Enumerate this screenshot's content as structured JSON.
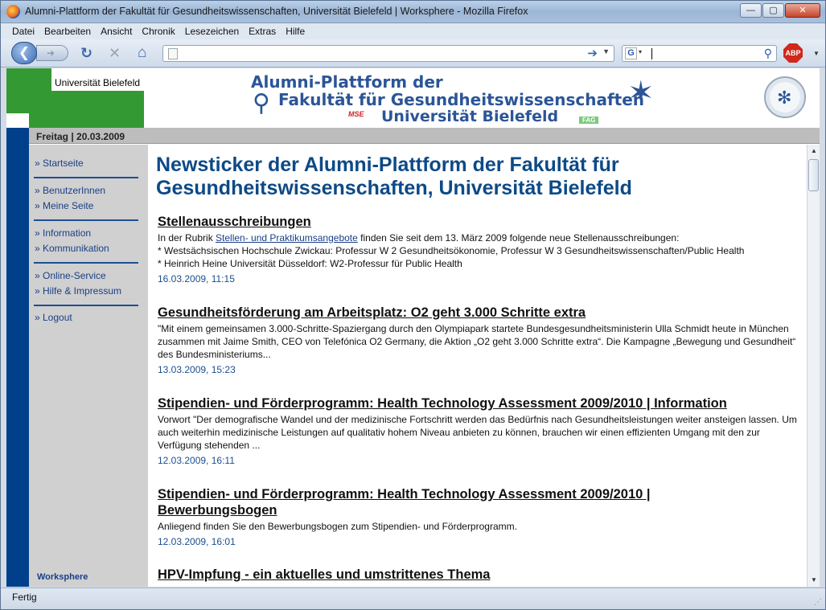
{
  "window": {
    "title": "Alumni-Plattform der Fakultät für Gesundheitswissenschaften, Universität Bielefeld | Worksphere - Mozilla Firefox",
    "minimize_glyph": "—",
    "maximize_glyph": "▢",
    "close_glyph": "✕"
  },
  "menu": [
    "Datei",
    "Bearbeiten",
    "Ansicht",
    "Chronik",
    "Lesezeichen",
    "Extras",
    "Hilfe"
  ],
  "toolbar": {
    "url_value": "",
    "search_value": "",
    "search_engine_letter": "G",
    "adblock_label": "ABP",
    "icons": [
      "back-icon",
      "forward-icon",
      "reload-icon",
      "stop-icon",
      "home-icon",
      "go-icon",
      "search-icon"
    ]
  },
  "site": {
    "university_label": "Universität Bielefeld",
    "banner": {
      "line1": "Alumni-Plattform der",
      "line2": "Fakultät für Gesundheitswissenschaften",
      "line3": "Universität Bielefeld",
      "mse_label": "MSE",
      "fag_label": "FAG"
    },
    "date": "Freitag | 20.03.2009"
  },
  "sidebar": {
    "groups": [
      [
        "» Startseite"
      ],
      [
        "» BenutzerInnen",
        "» Meine Seite"
      ],
      [
        "» Information",
        "» Kommunikation"
      ],
      [
        "» Online-Service",
        "» Hilfe & Impressum"
      ],
      [
        "» Logout"
      ]
    ],
    "footer": "Worksphere"
  },
  "content": {
    "heading_line1": "Newsticker der Alumni-Plattform der Fakultät für",
    "heading_line2": "Gesundheitswissenschaften, Universität Bielefeld",
    "items": [
      {
        "title": "Stellenausschreibungen",
        "body_pre": "In der Rubrik ",
        "body_link": "Stellen- und Praktikumsangebote",
        "body_post": " finden Sie seit dem 13. März 2009 folgende neue Stellenausschreibungen:",
        "lines": [
          "* Westsächsischen Hochschule Zwickau: Professur W 2 Gesundheitsökonomie, Professur W 3 Gesundheitswissenschaften/Public Health",
          "* Heinrich Heine Universität Düsseldorf: W2-Professur für Public Health"
        ],
        "date": "16.03.2009, 11:15"
      },
      {
        "title": "Gesundheitsförderung am Arbeitsplatz: O2 geht 3.000 Schritte extra",
        "body": "\"Mit einem gemeinsamen 3.000-Schritte-Spaziergang durch den Olympiapark startete Bundesgesundheitsministerin Ulla Schmidt heute in München zusammen mit Jaime Smith, CEO von Telefónica O2 Germany, die Aktion „O2 geht 3.000 Schritte extra“. Die Kampagne „Bewegung und Gesundheit“ des Bundesministeriums...",
        "date": "13.03.2009, 15:23"
      },
      {
        "title": "Stipendien- und Förderprogramm: Health Technology Assessment 2009/2010 | Information",
        "body": "Vorwort \"Der demografische Wandel und der medizinische Fortschritt werden das Bedürfnis nach Gesundheitsleistungen weiter ansteigen lassen. Um auch weiterhin medizinische Leistungen auf qualitativ hohem Niveau anbieten zu können, brauchen wir einen effizienten Umgang mit den zur Verfügung stehenden ...",
        "date": "12.03.2009, 16:11"
      },
      {
        "title": "Stipendien- und Förderprogramm: Health Technology Assessment 2009/2010 | Bewerbungsbogen",
        "body": "Anliegend finden Sie den Bewerbungsbogen zum Stipendien- und Förderprogramm.",
        "date": "12.03.2009, 16:01"
      },
      {
        "title": "HPV-Impfung - ein aktuelles und umstrittenes Thema",
        "body": "",
        "date": ""
      }
    ]
  },
  "status": {
    "text": "Fertig"
  }
}
